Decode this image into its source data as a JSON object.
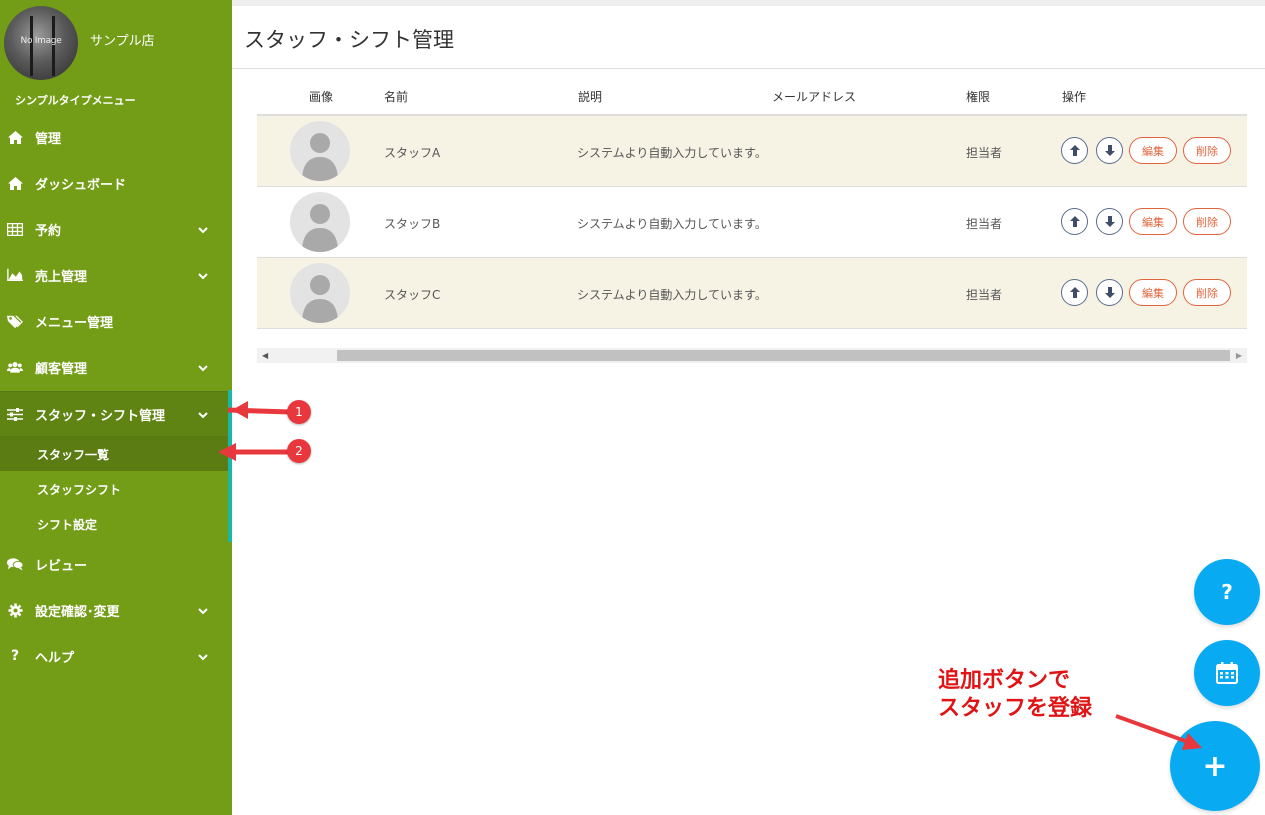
{
  "shop": {
    "name": "サンプル店",
    "avatar_placeholder": "No Image"
  },
  "menu_type": "シンプルタイプメニュー",
  "nav": {
    "items": [
      {
        "label": "管理",
        "icon": "home-icon"
      },
      {
        "label": "ダッシュボード",
        "icon": "home-icon"
      },
      {
        "label": "予約",
        "icon": "table-icon"
      },
      {
        "label": "売上管理",
        "icon": "area-chart-icon"
      },
      {
        "label": "メニュー管理",
        "icon": "tags-icon"
      },
      {
        "label": "顧客管理",
        "icon": "users-icon"
      },
      {
        "label": "スタッフ・シフト管理",
        "icon": "sliders-icon"
      },
      {
        "label": "レビュー",
        "icon": "comments-icon"
      },
      {
        "label": "設定確認･変更",
        "icon": "gear-icon"
      },
      {
        "label": "ヘルプ",
        "icon": "question-icon"
      }
    ],
    "sub_items": [
      {
        "label": "スタッフ一覧"
      },
      {
        "label": "スタッフシフト"
      },
      {
        "label": "シフト設定"
      }
    ]
  },
  "page": {
    "title": "スタッフ・シフト管理"
  },
  "table": {
    "headers": {
      "image": "画像",
      "name": "名前",
      "description": "説明",
      "email": "メールアドレス",
      "role": "権限",
      "actions": "操作"
    },
    "rows": [
      {
        "name": "スタッフA",
        "description": "システムより自動入力しています。",
        "email": "",
        "role": "担当者"
      },
      {
        "name": "スタッフB",
        "description": "システムより自動入力しています。",
        "email": "",
        "role": "担当者"
      },
      {
        "name": "スタッフC",
        "description": "システムより自動入力しています。",
        "email": "",
        "role": "担当者"
      }
    ],
    "action_labels": {
      "edit": "編集",
      "delete": "削除"
    }
  },
  "fab": {
    "help_label": "?",
    "add_label": "+"
  },
  "annotations": {
    "badge1": "1",
    "badge2": "2",
    "note_line1": "追加ボタンで",
    "note_line2": "スタッフを登録"
  },
  "colors": {
    "sidebar": "#739c17",
    "sidebar_active": "#5f8413",
    "accent_teal": "#1ab6a8",
    "fab": "#08aaf2",
    "row_highlight": "#f6f3e5",
    "delete_edit": "#e0643c",
    "annotation_red": "#e01414"
  }
}
